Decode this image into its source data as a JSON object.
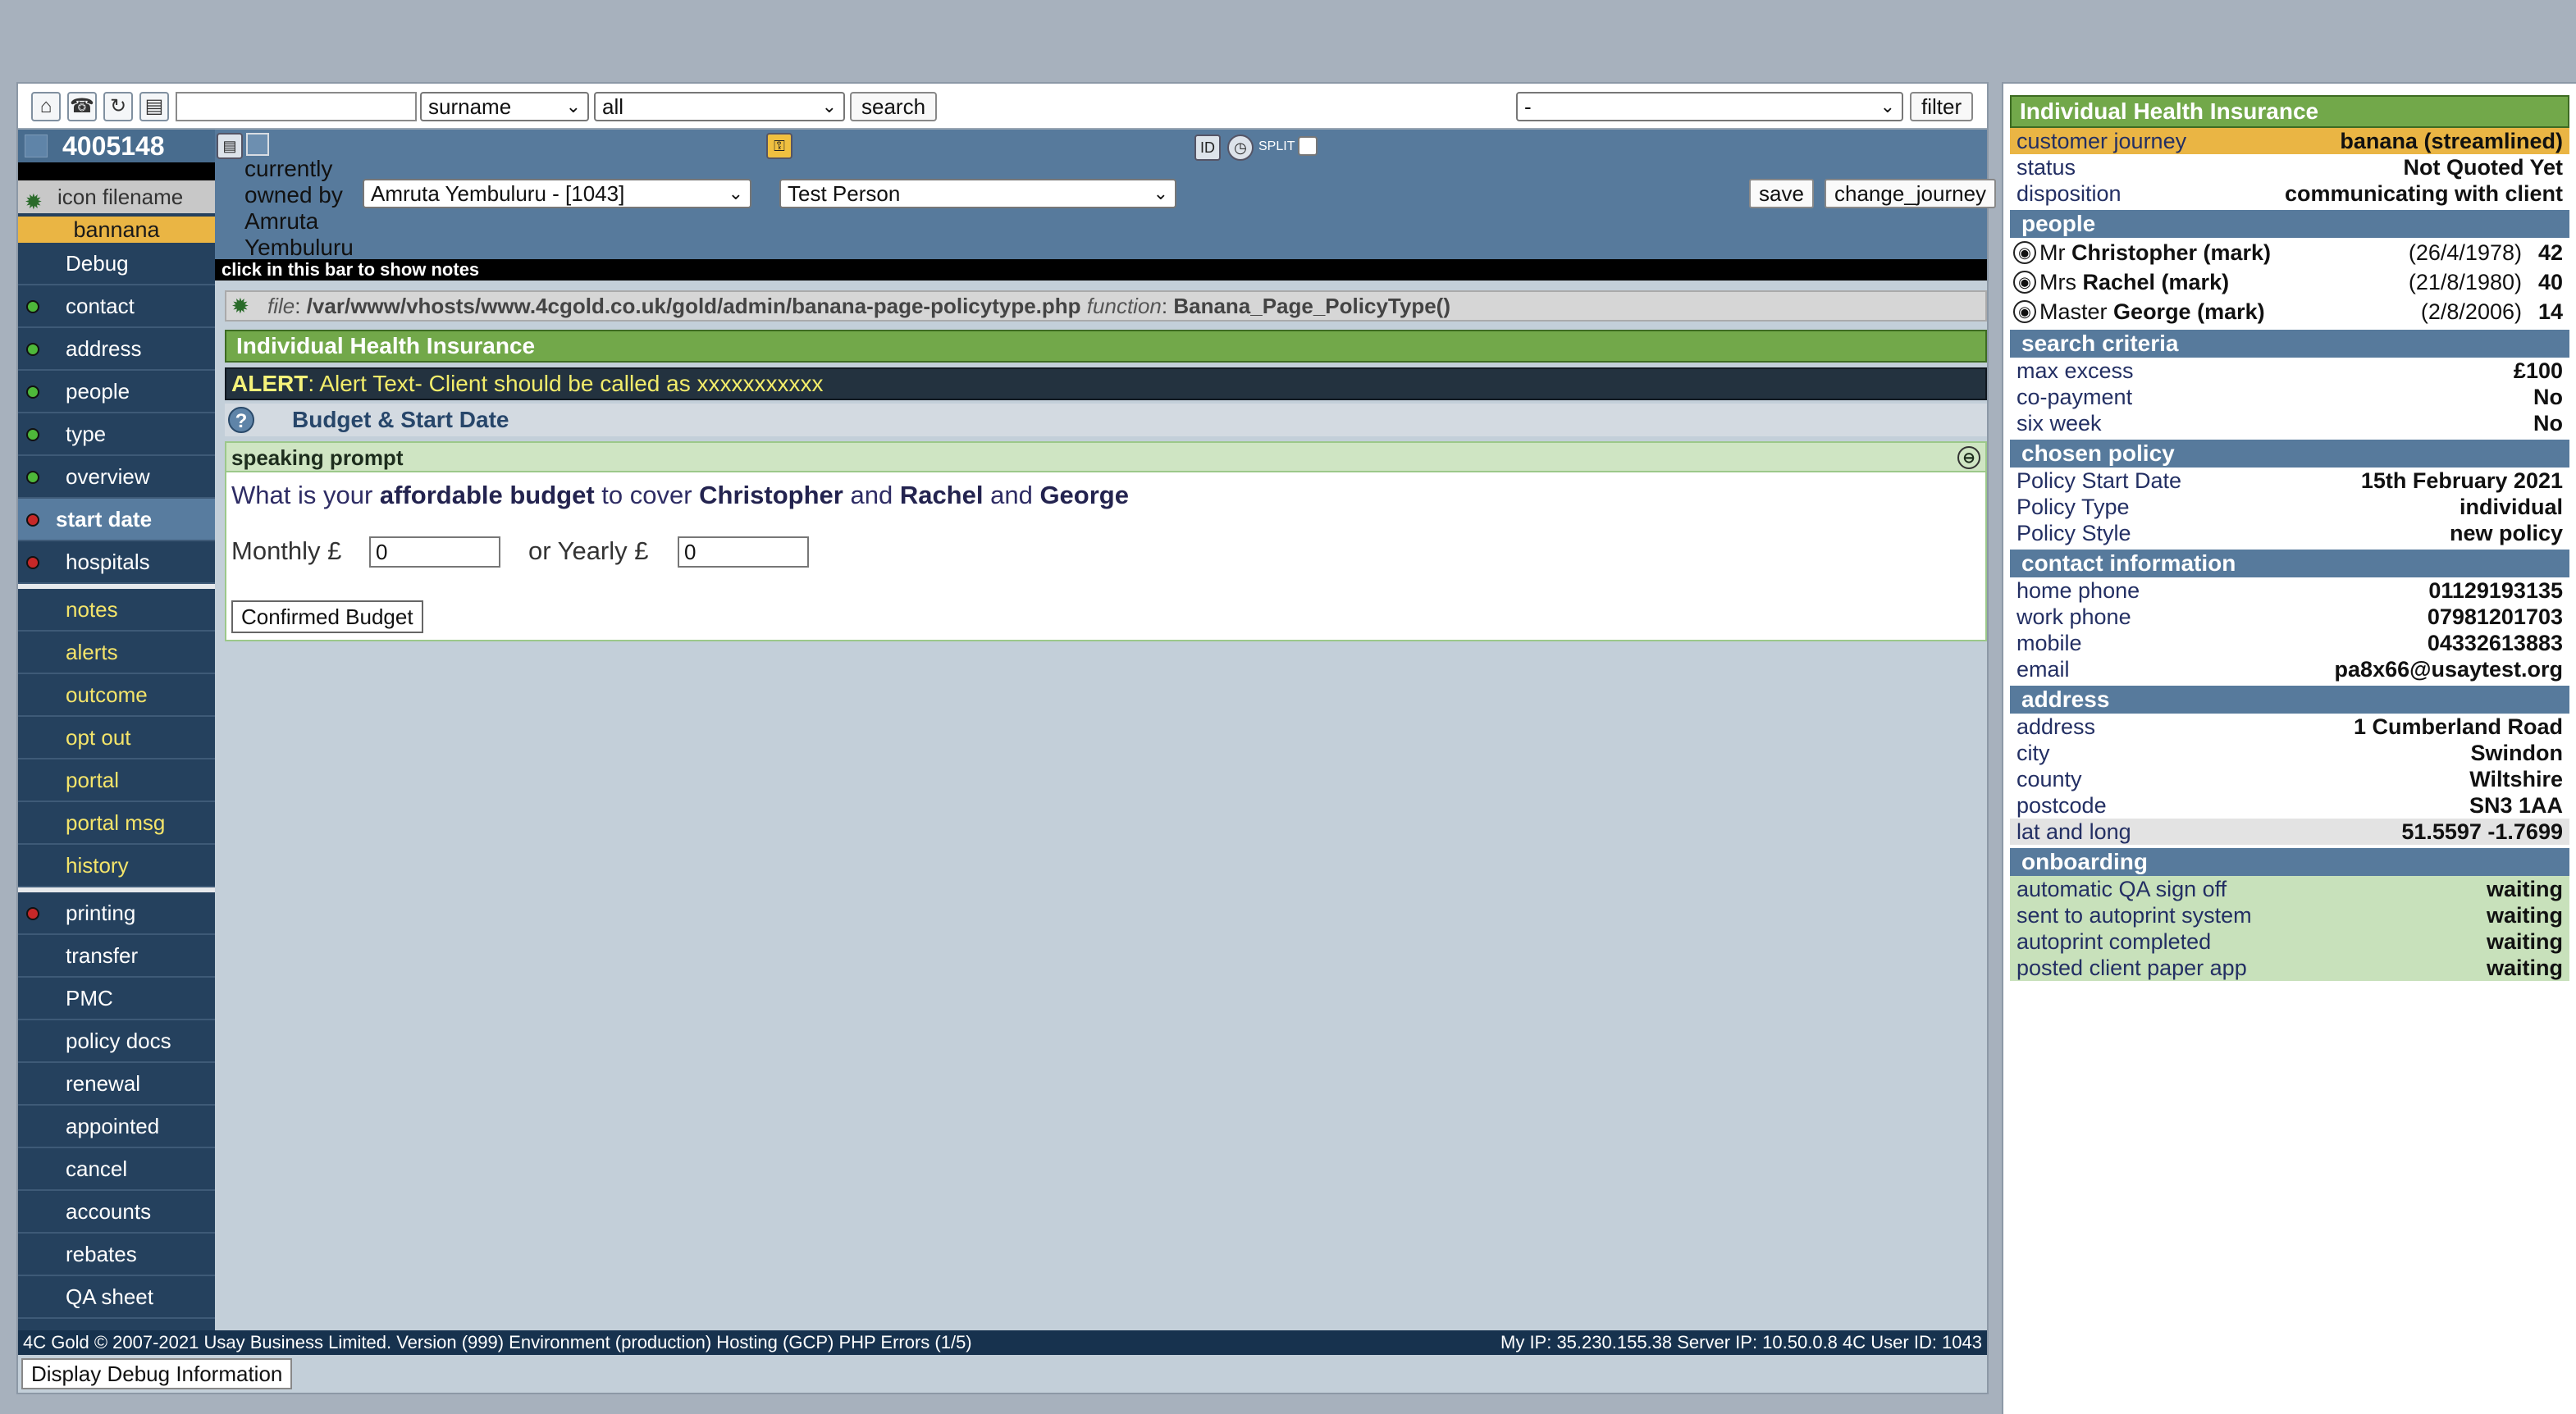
{
  "toolbar": {
    "icons": [
      "home-icon",
      "phone-icon",
      "refresh-icon",
      "document-icon"
    ],
    "search_value": "",
    "field_select": "surname",
    "scope_select": "all",
    "search_label": "search",
    "filter_select": "-",
    "filter_label": "filter"
  },
  "left_nav": {
    "client_id": "4005148",
    "icon_filename": "icon filename",
    "journey_tag": "bannana",
    "items": [
      {
        "label": "Debug",
        "dot": ""
      },
      {
        "label": "contact",
        "dot": "green"
      },
      {
        "label": "address",
        "dot": "green"
      },
      {
        "label": "people",
        "dot": "green"
      },
      {
        "label": "type",
        "dot": "green"
      },
      {
        "label": "overview",
        "dot": "green"
      },
      {
        "label": "start date",
        "dot": "red"
      },
      {
        "label": "hospitals",
        "dot": "red"
      }
    ],
    "notes_items": [
      "notes",
      "alerts",
      "outcome",
      "opt out",
      "portal",
      "portal msg",
      "history"
    ],
    "tools_items": [
      {
        "label": "printing",
        "dot": "red"
      },
      {
        "label": "transfer",
        "dot": ""
      },
      {
        "label": "PMC",
        "dot": ""
      },
      {
        "label": "policy docs",
        "dot": ""
      },
      {
        "label": "renewal",
        "dot": ""
      },
      {
        "label": "appointed",
        "dot": ""
      },
      {
        "label": "cancel",
        "dot": ""
      },
      {
        "label": "accounts",
        "dot": ""
      },
      {
        "label": "rebates",
        "dot": ""
      },
      {
        "label": "QA sheet",
        "dot": ""
      }
    ]
  },
  "header": {
    "owner_label": "currently owned by Amruta Yembuluru",
    "owner_select": "Amruta Yembuluru - [1043]",
    "person_select": "Test Person",
    "save_label": "save",
    "change_journey_label": "change_journey",
    "split_label": "SPLIT",
    "notes_bar": "click in this bar to show notes"
  },
  "main": {
    "file_label": "file",
    "file_path": "/var/www/vhosts/www.4cgold.co.uk/gold/admin/banana-page-policytype.php",
    "function_label": "function",
    "function_name": "Banana_Page_PolicyType()",
    "product_title": "Individual Health Insurance",
    "alert_label": "ALERT",
    "alert_text": ": Alert Text- Client should be called as xxxxxxxxxxx",
    "section_title": "Budget & Start Date",
    "prompt_title": "speaking prompt",
    "question": {
      "prefix": "What is your ",
      "budget_phrase": "affordable budget",
      "mid": " to cover ",
      "name1": "Christopher",
      "and1": " and ",
      "name2": "Rachel",
      "and2": " and ",
      "name3": "George"
    },
    "monthly_label": "Monthly £",
    "monthly_value": "0",
    "yearly_label": "or Yearly £",
    "yearly_value": "0",
    "confirm_label": "Confirmed Budget"
  },
  "footer": {
    "left": "4C Gold © 2007-2021 Usay Business Limited. Version (999) Environment (production) Hosting (GCP) PHP Errors (1/5)",
    "right": "My IP: 35.230.155.38 Server IP: 10.50.0.8 4C User ID: 1043",
    "debug_button": "Display Debug Information"
  },
  "right_panel": {
    "title": "Individual Health Insurance",
    "summary": [
      {
        "label": "customer journey",
        "value": "banana (streamlined)"
      },
      {
        "label": "status",
        "value": "Not Quoted Yet"
      },
      {
        "label": "disposition",
        "value": "communicating with client"
      }
    ],
    "people_head": "people",
    "people": [
      {
        "title": "Mr",
        "name": "Christopher (mark)",
        "dob": "(26/4/1978)",
        "age": "42"
      },
      {
        "title": "Mrs",
        "name": "Rachel (mark)",
        "dob": "(21/8/1980)",
        "age": "40"
      },
      {
        "title": "Master",
        "name": "George (mark)",
        "dob": "(2/8/2006)",
        "age": "14"
      }
    ],
    "search_head": "search criteria",
    "search": [
      {
        "label": "max excess",
        "value": "£100"
      },
      {
        "label": "co-payment",
        "value": "No"
      },
      {
        "label": "six week",
        "value": "No"
      }
    ],
    "policy_head": "chosen policy",
    "policy": [
      {
        "label": "Policy Start Date",
        "value": "15th February 2021"
      },
      {
        "label": "Policy Type",
        "value": "individual"
      },
      {
        "label": "Policy Style",
        "value": "new policy"
      }
    ],
    "contact_head": "contact information",
    "contact": [
      {
        "label": "home phone",
        "value": "01129193135"
      },
      {
        "label": "work phone",
        "value": "07981201703"
      },
      {
        "label": "mobile",
        "value": "04332613883"
      },
      {
        "label": "email",
        "value": "pa8x66@usaytest.org"
      }
    ],
    "address_head": "address",
    "address": [
      {
        "label": "address",
        "value": "1 Cumberland Road"
      },
      {
        "label": "city",
        "value": "Swindon"
      },
      {
        "label": "county",
        "value": "Wiltshire"
      },
      {
        "label": "postcode",
        "value": "SN3 1AA"
      },
      {
        "label": "lat and long",
        "value": "51.5597 -1.7699"
      }
    ],
    "onboarding_head": "onboarding",
    "onboarding": [
      {
        "label": "automatic QA sign off",
        "value": "waiting"
      },
      {
        "label": "sent to autoprint system",
        "value": "waiting"
      },
      {
        "label": "autoprint completed",
        "value": "waiting"
      },
      {
        "label": "posted client paper app",
        "value": "waiting"
      }
    ]
  }
}
